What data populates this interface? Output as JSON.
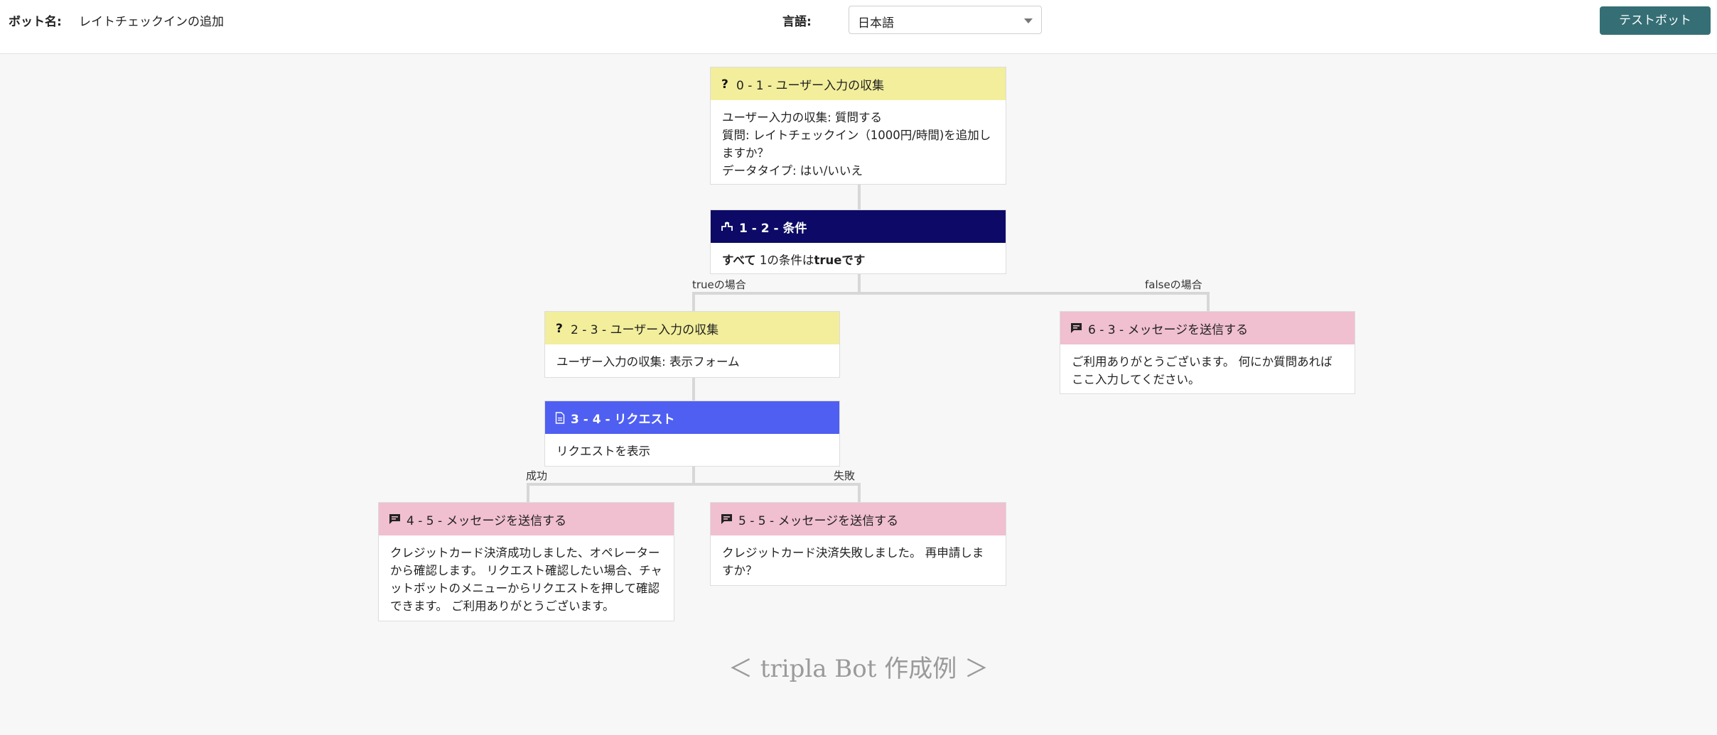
{
  "header": {
    "bot_name_label": "ボット名:",
    "bot_name_value": "レイトチェックインの追加",
    "language_label": "言語:",
    "language_value": "日本語",
    "test_bot_label": "テストボット"
  },
  "branches": {
    "true_label": "trueの場合",
    "false_label": "falseの場合",
    "success_label": "成功",
    "failure_label": "失敗"
  },
  "nodes": {
    "n0": {
      "title": "0 - 1 - ユーザー入力の収集",
      "icon": "question-icon",
      "lines": [
        "ユーザー入力の収集: 質問する",
        "質問: レイトチェックイン（1000円/時間)を追加しますか？",
        "データタイプ: はい/いいえ"
      ]
    },
    "n1": {
      "title": "1 - 2 - 条件",
      "icon": "condition-icon",
      "body_bold1": "すべて",
      "body_mid": " 1の条件は",
      "body_bold2": "trueです"
    },
    "n2": {
      "title": "2 - 3 - ユーザー入力の収集",
      "icon": "question-icon",
      "lines": [
        "ユーザー入力の収集: 表示フォーム"
      ]
    },
    "n6": {
      "title": "6 - 3 - メッセージを送信する",
      "icon": "chat-icon",
      "lines": [
        "ご利用ありがとうございます。 何にか質問あればここ入力してください。"
      ]
    },
    "n3": {
      "title": "3 - 4 - リクエスト",
      "icon": "document-icon",
      "lines": [
        "リクエストを表示"
      ]
    },
    "n4": {
      "title": "4 - 5 - メッセージを送信する",
      "icon": "chat-icon",
      "lines": [
        "クレジットカード決済成功しました、オペレーターから確認します。 リクエスト確認したい場合、チャットボットのメニューからリクエストを押して確認できます。 ご利用ありがとうございます。"
      ]
    },
    "n5": {
      "title": "5 - 5 - メッセージを送信する",
      "icon": "chat-icon",
      "lines": [
        "クレジットカード決済失敗しました。 再申請しますか？"
      ]
    }
  },
  "caption": "＜ tripla Bot 作成例 ＞"
}
